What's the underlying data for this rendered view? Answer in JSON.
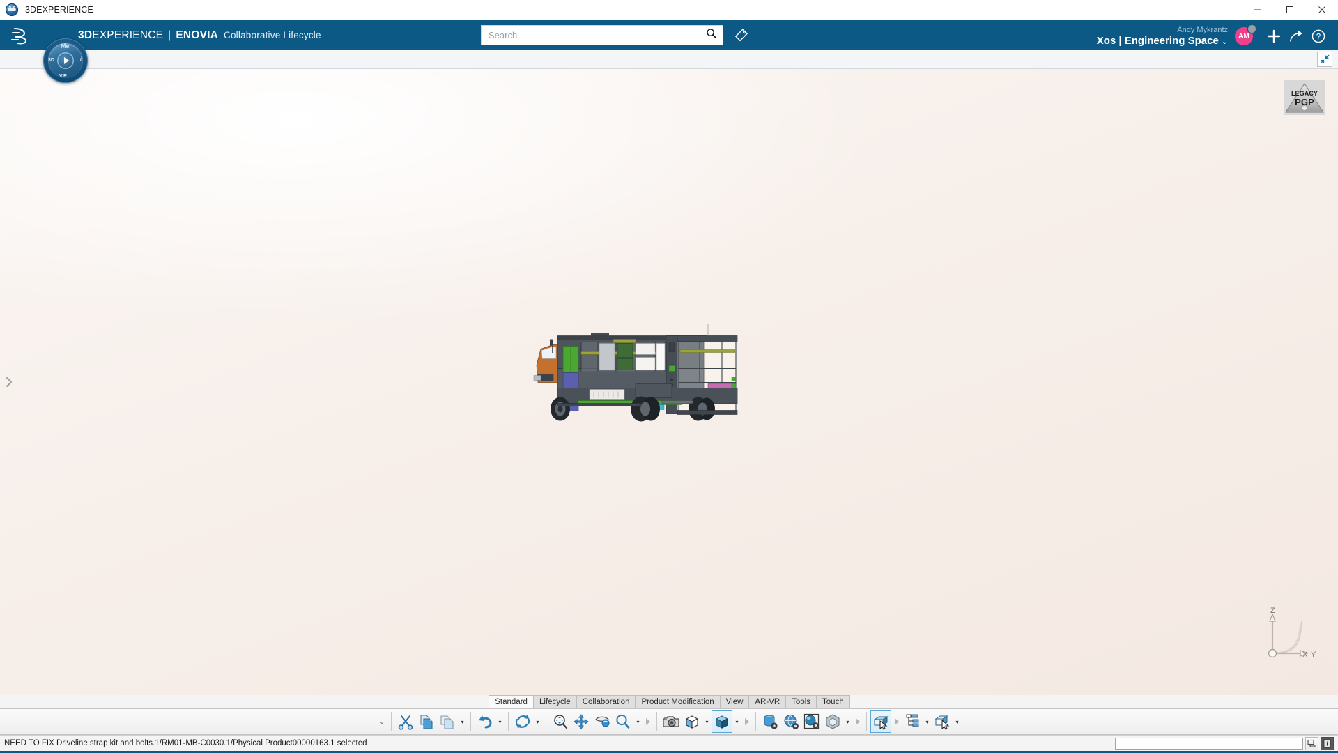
{
  "window": {
    "title": "3DEXPERIENCE",
    "app_icon": "3dexperience-globe-icon",
    "controls": {
      "minimize": "minimize-icon",
      "maximize": "maximize-icon",
      "close": "close-icon"
    }
  },
  "topbar": {
    "logo": "dassault-systemes-logo",
    "compass": {
      "label_3d": "3D",
      "label_i": "i",
      "label_vr": "V.R",
      "label_me": "Me"
    },
    "brand_bold": "3D",
    "brand_rest": "EXPERIENCE",
    "brand_sep": "|",
    "brand_product": "ENOVIA",
    "brand_subtitle": "Collaborative Lifecycle",
    "search": {
      "placeholder": "Search",
      "value": "",
      "icon": "search-icon"
    },
    "tag_icon": "tag-icon",
    "user": {
      "name": "Andy Mykrantz",
      "space": "Xos | Engineering Space",
      "chevron": "⌄",
      "avatar_initials": "AM",
      "avatar_color": "#f0408c",
      "status_dot_color": "#9aa0a6"
    },
    "actions": [
      {
        "name": "add-button",
        "icon": "plus-icon",
        "label": "+"
      },
      {
        "name": "share-button",
        "icon": "share-arrow-icon",
        "label": ""
      },
      {
        "name": "help-button",
        "icon": "help-question-icon",
        "label": "?"
      }
    ],
    "background_color": "#0d5986"
  },
  "substrip": {
    "collapse_pane_button": "collapse-panel-icon"
  },
  "viewport": {
    "background_color": "#f7efea",
    "legacy_badge": {
      "line1": "LEGACY",
      "line2": "PGP",
      "icon": "warning-triangle-icon"
    },
    "pane_toggle": "chevron-right-icon",
    "axis_triad": {
      "z": "Z",
      "x": "X",
      "y": "Y"
    },
    "model": {
      "name": "electric-delivery-truck-assembly",
      "description": "3D CAD assembly of a box-body electric step-van truck, side view",
      "colors": {
        "body": "#4a5159",
        "dark_frame": "#3a4148",
        "cab": "#c4702e",
        "green_panel": "#4aa832",
        "blue_panel": "#5a5fb0",
        "magenta_panel": "#c86bb0",
        "olive_rail": "#9aa33c",
        "light_gray": "#b9bcc0",
        "cyan_accent": "#3fb8d8"
      }
    }
  },
  "bottom_toolbar": {
    "tabs": [
      {
        "label": "Standard",
        "active": true
      },
      {
        "label": "Lifecycle",
        "active": false
      },
      {
        "label": "Collaboration",
        "active": false
      },
      {
        "label": "Product Modification",
        "active": false
      },
      {
        "label": "View",
        "active": false
      },
      {
        "label": "AR-VR",
        "active": false
      },
      {
        "label": "Tools",
        "active": false
      },
      {
        "label": "Touch",
        "active": false
      }
    ],
    "handle": "⌄",
    "groups": [
      {
        "name": "clipboard-group",
        "items": [
          {
            "name": "cut-button",
            "icon": "scissors-icon",
            "dropdown": false,
            "selected": false
          },
          {
            "name": "copy-button",
            "icon": "copy-icon",
            "dropdown": false,
            "selected": false
          },
          {
            "name": "paste-button",
            "icon": "paste-icon",
            "dropdown": true,
            "selected": false
          }
        ]
      },
      {
        "name": "undo-group",
        "items": [
          {
            "name": "undo-button",
            "icon": "undo-arrow-icon",
            "dropdown": true,
            "selected": false
          }
        ]
      },
      {
        "name": "update-group",
        "items": [
          {
            "name": "update-button",
            "icon": "refresh-cycle-icon",
            "dropdown": true,
            "selected": false
          }
        ]
      },
      {
        "name": "navigation-group",
        "items": [
          {
            "name": "zoom-area-button",
            "icon": "magnifier-move-icon",
            "dropdown": false,
            "selected": false
          },
          {
            "name": "pan-button",
            "icon": "four-arrows-pan-icon",
            "dropdown": false,
            "selected": false
          },
          {
            "name": "rotate-button",
            "icon": "rotate-hand-icon",
            "dropdown": false,
            "selected": false
          },
          {
            "name": "zoom-button",
            "icon": "magnifier-icon",
            "dropdown": true,
            "arrow": true,
            "selected": false
          }
        ]
      },
      {
        "name": "view-group",
        "items": [
          {
            "name": "capture-button",
            "icon": "camera-icon",
            "dropdown": false,
            "selected": false
          },
          {
            "name": "fit-all-button",
            "icon": "wireframe-cube-icon",
            "dropdown": true,
            "selected": false
          },
          {
            "name": "shading-button",
            "icon": "shaded-cube-icon",
            "dropdown": true,
            "arrow": true,
            "selected": true
          }
        ]
      },
      {
        "name": "tools-group",
        "items": [
          {
            "name": "cylinder-settings-button",
            "icon": "cylinder-gear-icon",
            "dropdown": false,
            "selected": false
          },
          {
            "name": "globe-settings-button",
            "icon": "globe-gear-icon",
            "dropdown": false,
            "selected": false
          },
          {
            "name": "sphere-settings-button",
            "icon": "sphere-gear-icon",
            "dropdown": false,
            "selected": false
          },
          {
            "name": "hex-tool-button",
            "icon": "hexagon-icon",
            "dropdown": true,
            "arrow": true,
            "selected": false
          }
        ]
      },
      {
        "name": "selection-group",
        "items": [
          {
            "name": "select-box-button",
            "icon": "box-cursor-icon",
            "dropdown": false,
            "arrow": true,
            "selected": true
          },
          {
            "name": "tree-order-button",
            "icon": "tree-structure-icon",
            "dropdown": true,
            "selected": false
          },
          {
            "name": "pick-part-button",
            "icon": "cube-pick-cursor-icon",
            "dropdown": true,
            "selected": false
          }
        ]
      }
    ]
  },
  "statusbar": {
    "message": "NEED TO FIX Driveline strap kit and bolts.1/RM01-MB-C0030.1/Physical Product00000163.1 selected",
    "input_value": "",
    "buttons": [
      {
        "name": "window-toggle-button",
        "icon": "window-icon"
      },
      {
        "name": "info-button",
        "icon": "info-icon"
      }
    ],
    "accent_color": "#0d5986"
  }
}
